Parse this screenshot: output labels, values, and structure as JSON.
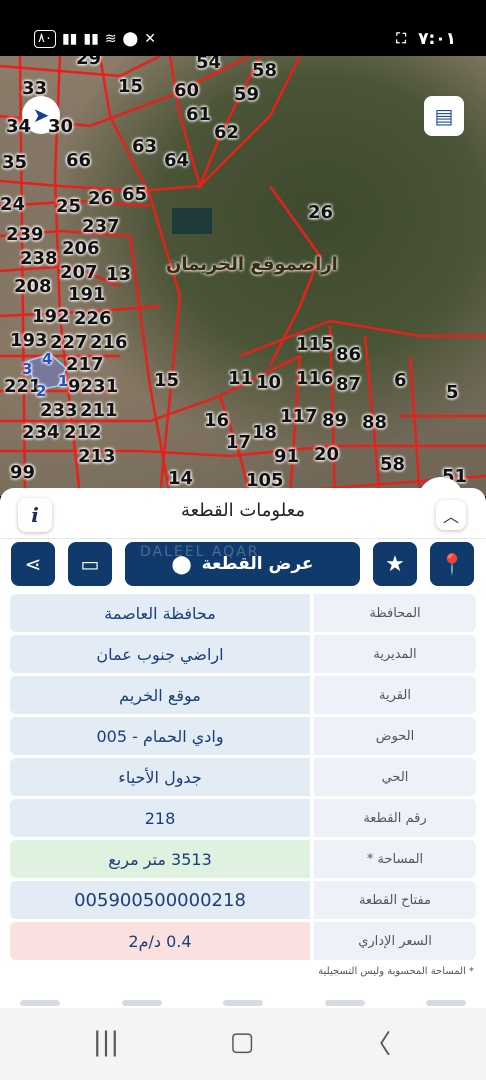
{
  "status_bar": {
    "time": "٧:٠١",
    "battery": "٨٠",
    "icons": [
      "signal-icon",
      "signal-icon",
      "wifi-icon",
      "location-icon",
      "mute-icon",
      "screen-capture-icon"
    ]
  },
  "map": {
    "location_label": "اراضموقع الخريمان",
    "parcel_numbers": [
      "29",
      "54",
      "58",
      "33",
      "15",
      "60",
      "59",
      "61",
      "34",
      "30",
      "62",
      "63",
      "35",
      "66",
      "64",
      "24",
      "25",
      "26",
      "65",
      "26",
      "239",
      "237",
      "206",
      "238",
      "207",
      "13",
      "208",
      "191",
      "192",
      "226",
      "193",
      "227",
      "216",
      "217",
      "115",
      "86",
      "221",
      "9231",
      "15",
      "11",
      "10",
      "116",
      "87",
      "6",
      "5",
      "233",
      "211",
      "16",
      "117",
      "89",
      "88",
      "234",
      "212",
      "17",
      "18",
      "213",
      "91",
      "20",
      "58",
      "99",
      "14",
      "105",
      "51",
      "3",
      "4",
      "2",
      "1"
    ]
  },
  "panel": {
    "title": "معلومات القطعة",
    "info_label": "i",
    "show_parcel_label": "عرض القطعة",
    "watermark": "DALEEL AQAR",
    "rows": [
      {
        "label": "المحافظة",
        "value": "محافظة العاصمة"
      },
      {
        "label": "المديرية",
        "value": "اراضي جنوب عمان"
      },
      {
        "label": "القرية",
        "value": "موقع الخريم"
      },
      {
        "label": "الحوض",
        "value": "وادي الحمام - 005"
      },
      {
        "label": "الحي",
        "value": "جدول الأحياء"
      },
      {
        "label": "رقم القطعة",
        "value": "218"
      },
      {
        "label": "المساحة *",
        "value": "3513   متر مربع"
      },
      {
        "label": "مفتاح القطعة",
        "value": "005900500000218"
      },
      {
        "label": "السعر الإداري",
        "value": "0.4 د/م2"
      }
    ],
    "footnote": "* المساحة المحسوبة وليس التسجيلية"
  },
  "colors": {
    "primary": "#0f3a6b",
    "parcel_line": "#e8201c",
    "area_bg": "#dff1df",
    "price_bg": "#fbe0e0"
  }
}
